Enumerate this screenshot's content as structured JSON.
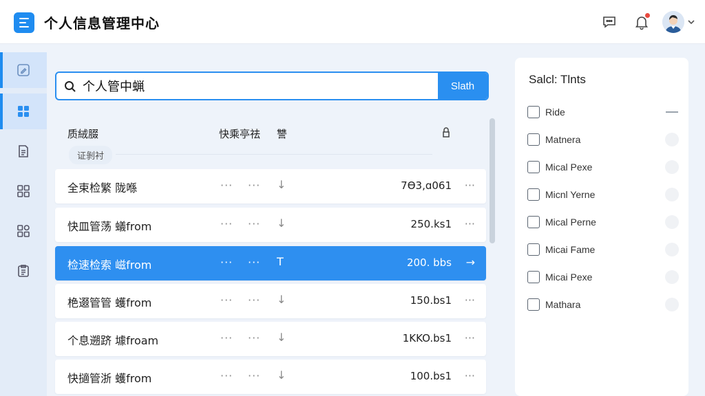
{
  "header": {
    "title": "个人信息管理中心"
  },
  "search": {
    "value": "个人管中蝋",
    "button_label": "Slath"
  },
  "table": {
    "headers": {
      "name": "质絨腏",
      "actions": "快乘亭祛",
      "col3": "讐"
    },
    "tag": "证剝衬",
    "rows": [
      {
        "name": "全束检繁 陇喺",
        "dots1": "···",
        "dots2": "···",
        "arrow": "↓",
        "size": "7Ɵ3,ɑ061",
        "more": "···",
        "selected": false
      },
      {
        "name": "快皿管荡 蟻from",
        "dots1": "···",
        "dots2": "···",
        "arrow": "↓",
        "size": "250.ks1",
        "more": "···",
        "selected": false
      },
      {
        "name": "检速检索 嵫fr​om",
        "dots1": "···",
        "dots2": "···",
        "arrow": "T",
        "size": "200. bbs",
        "more": "→",
        "selected": true
      },
      {
        "name": "栬逫管管 蠖from",
        "dots1": "···",
        "dots2": "···",
        "arrow": "↓",
        "size": "150.bs1",
        "more": "···",
        "selected": false
      },
      {
        "name": "个息遡跻 壉froam",
        "dots1": "···",
        "dots2": "···",
        "arrow": "↓",
        "size": "1KKO.bs1",
        "more": "···",
        "selected": false
      },
      {
        "name": "快擿管浙 蠖from",
        "dots1": "···",
        "dots2": "···",
        "arrow": "↓",
        "size": "100.bs1",
        "more": "···",
        "selected": false
      }
    ]
  },
  "side": {
    "title": "Salcl: Tlnts",
    "options": [
      {
        "label": "Ride",
        "knob": "dash"
      },
      {
        "label": "Matnera",
        "knob": "circle"
      },
      {
        "label": "Mical Pexe",
        "knob": "circle"
      },
      {
        "label": "Micnl Yerne",
        "knob": "circle"
      },
      {
        "label": "Mical Perne",
        "knob": "circle"
      },
      {
        "label": "Micai Fame",
        "knob": "circle"
      },
      {
        "label": "Micai Pexe",
        "knob": "circle"
      },
      {
        "label": "Mathara",
        "knob": "circle"
      }
    ]
  },
  "colors": {
    "accent": "#2a8ff0",
    "selected_row": "#2e8ff0",
    "notification": "#e94a3f"
  }
}
